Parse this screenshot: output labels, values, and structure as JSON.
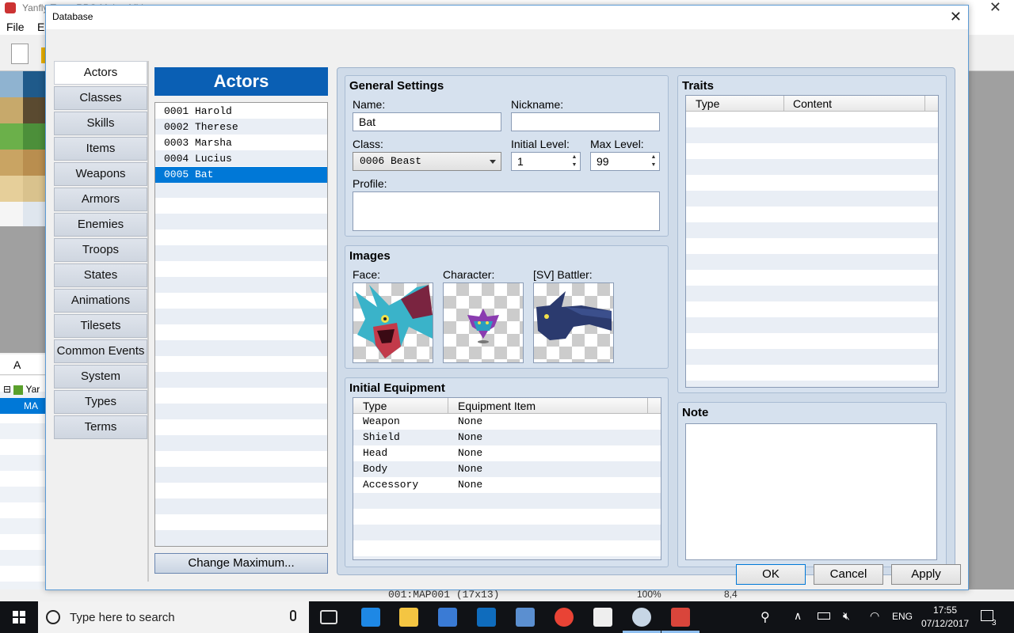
{
  "background_app": {
    "title": "Yanfly Test - RPG Maker MV",
    "menu": [
      "File",
      "Ed"
    ],
    "tab_a": "A",
    "tree_root": "Yar",
    "tree_map": "MA",
    "status_map": "001:MAP001 (17x13)",
    "status_zoom": "100%",
    "status_coords": "8,4"
  },
  "dialog": {
    "title": "Database",
    "close_icon": "close-icon"
  },
  "categories": [
    "Actors",
    "Classes",
    "Skills",
    "Items",
    "Weapons",
    "Armors",
    "Enemies",
    "Troops",
    "States",
    "Animations",
    "Tilesets",
    "Common Events",
    "System",
    "Types",
    "Terms"
  ],
  "active_category": "Actors",
  "actors_panel": {
    "header": "Actors",
    "items": [
      "0001 Harold",
      "0002 Therese",
      "0003 Marsha",
      "0004 Lucius",
      "0005 Bat"
    ],
    "selected_index": 4,
    "change_max_label": "Change Maximum..."
  },
  "general": {
    "title": "General Settings",
    "name_label": "Name:",
    "name_value": "Bat",
    "nickname_label": "Nickname:",
    "nickname_value": "",
    "class_label": "Class:",
    "class_value": "0006 Beast",
    "initial_level_label": "Initial Level:",
    "initial_level_value": "1",
    "max_level_label": "Max Level:",
    "max_level_value": "99",
    "profile_label": "Profile:",
    "profile_value": ""
  },
  "images": {
    "title": "Images",
    "face_label": "Face:",
    "character_label": "Character:",
    "battler_label": "[SV] Battler:"
  },
  "equipment": {
    "title": "Initial Equipment",
    "col_type": "Type",
    "col_item": "Equipment Item",
    "rows": [
      {
        "type": "Weapon",
        "item": "None"
      },
      {
        "type": "Shield",
        "item": "None"
      },
      {
        "type": "Head",
        "item": "None"
      },
      {
        "type": "Body",
        "item": "None"
      },
      {
        "type": "Accessory",
        "item": "None"
      }
    ]
  },
  "traits": {
    "title": "Traits",
    "col_type": "Type",
    "col_content": "Content"
  },
  "note": {
    "title": "Note",
    "value": ""
  },
  "buttons": {
    "ok": "OK",
    "cancel": "Cancel",
    "apply": "Apply"
  },
  "taskbar": {
    "search_placeholder": "Type here to search",
    "language": "ENG",
    "time": "17:55",
    "date": "07/12/2017",
    "notification_count": "3"
  },
  "colors": {
    "accent": "#0078d7",
    "actors_header": "#0a5fb4",
    "panel": "#d6e1ee"
  }
}
